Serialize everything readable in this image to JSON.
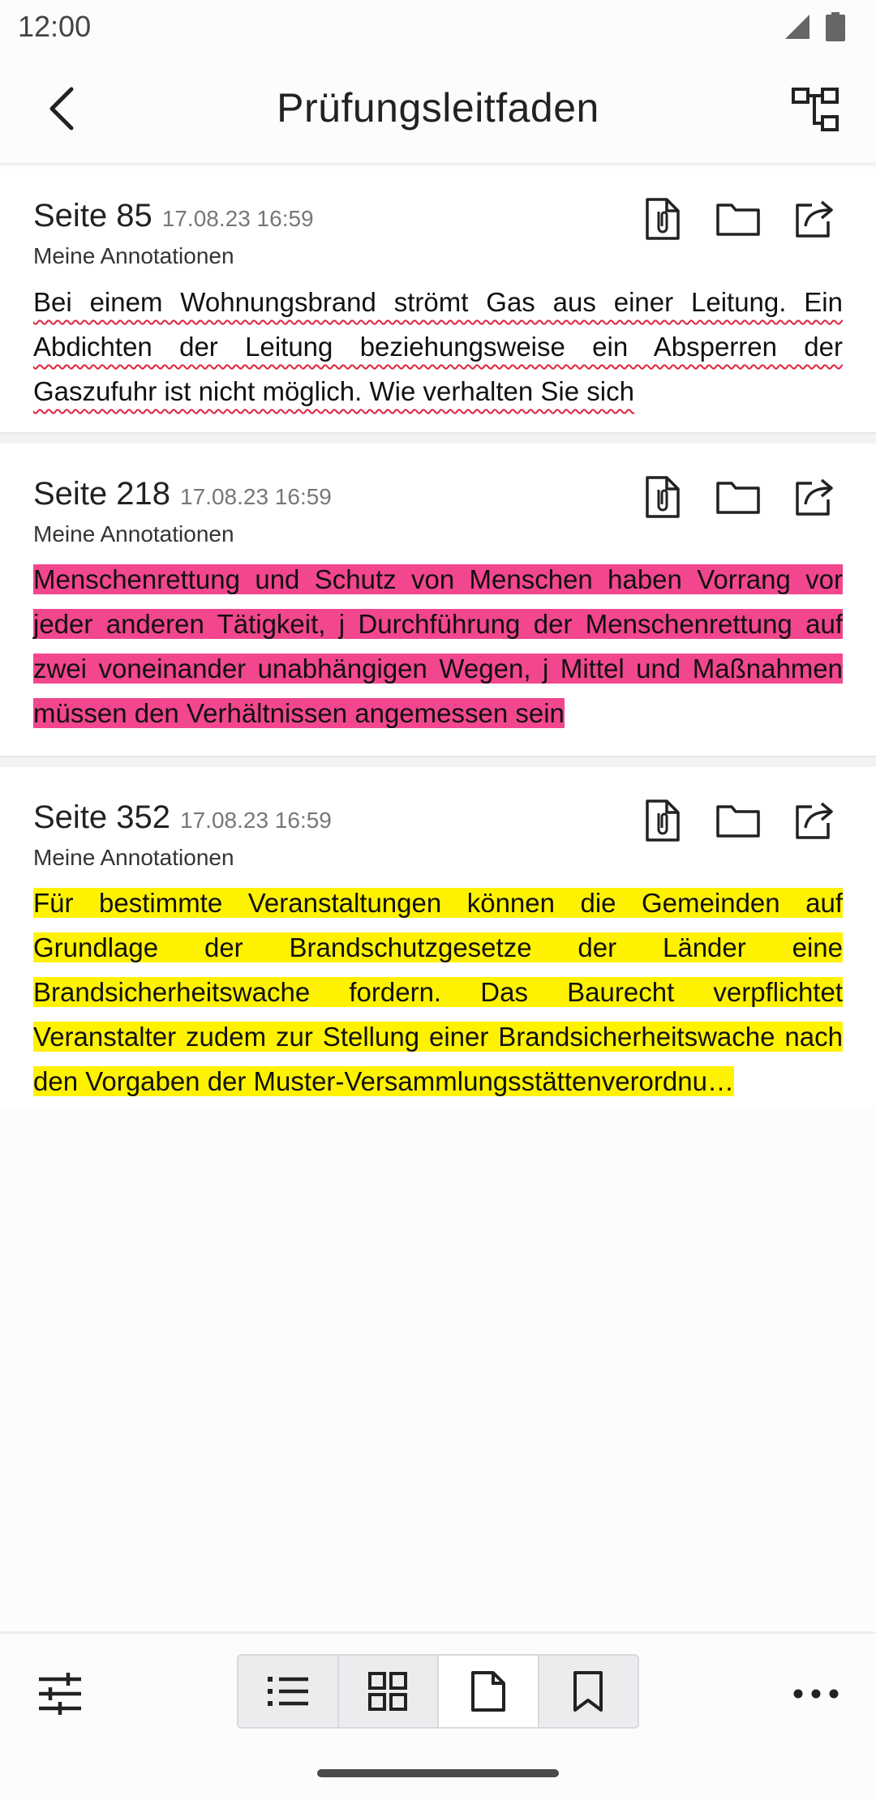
{
  "status": {
    "time": "12:00"
  },
  "header": {
    "title": "Prüfungsleitfaden"
  },
  "annotations": [
    {
      "page": "Seite 85",
      "date": "17.08.23 16:59",
      "subtitle": "Meine Annotationen",
      "text": "Bei einem Wohnungsbrand strömt Gas aus einer Leitung. Ein Abdichten der Leitung beziehungsweise ein Absperren der Gaszufuhr ist nicht möglich. Wie verhalten Sie sich",
      "style": "wavy-underline",
      "color": "#e0233e"
    },
    {
      "page": "Seite 218",
      "date": "17.08.23 16:59",
      "subtitle": "Meine Annotationen",
      "text": "Menschenrettung und Schutz von Menschen haben Vorrang vor jeder anderen Tätigkeit, j Durchführung der Menschenrettung auf zwei voneinander unabhängigen Wegen, j Mittel und Maßnahmen müssen den Verhältnissen angemessen sein",
      "style": "highlight",
      "color": "#f2468e"
    },
    {
      "page": "Seite 352",
      "date": "17.08.23 16:59",
      "subtitle": "Meine Annotationen",
      "text": "Für bestimmte Veranstaltungen können die Gemeinden auf Grundlage der Brandschutzgesetze der Länder eine Brandsicherheitswache fordern. Das Baurecht verpflichtet Veranstalter zudem zur Stellung einer Brandsicherheitswache nach den Vorgaben der Muster-Versammlungsstättenverordnu…",
      "style": "highlight",
      "color": "#fff200"
    }
  ],
  "icons": {
    "back": "arrow-back-icon",
    "tree": "hierarchy-icon",
    "attach": "attachment-document-icon",
    "folder": "folder-icon",
    "share": "share-icon",
    "filter": "tune-icon",
    "list": "list-icon",
    "grid": "grid-icon",
    "page": "page-icon",
    "bookmark": "bookmark-icon",
    "more": "more-horizontal-icon"
  },
  "view_switcher": {
    "active": "page"
  }
}
